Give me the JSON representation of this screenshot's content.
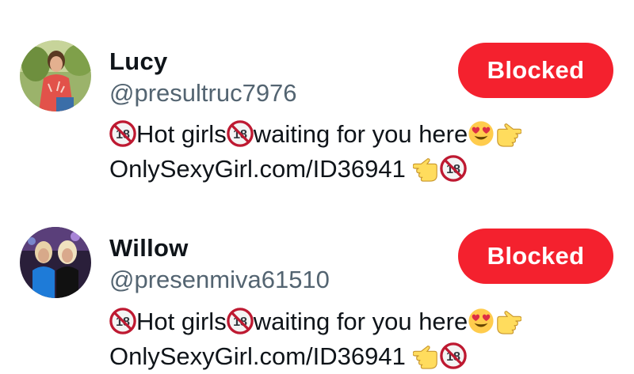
{
  "blocked_users": [
    {
      "name": "Lucy",
      "handle": "@presultruc7976",
      "button_label": "Blocked",
      "bio": {
        "line1_part1": "Hot girls",
        "line1_part2": "waiting for you here",
        "line2_text": "OnlySexyGirl.com/ID36941",
        "icons": [
          "no-under-18-icon",
          "heart-eyes-emoji-icon",
          "pointing-right-icon",
          "pointing-left-icon"
        ]
      }
    },
    {
      "name": "Willow",
      "handle": "@presenmiva61510",
      "button_label": "Blocked",
      "bio": {
        "line1_part1": "Hot girls",
        "line1_part2": "waiting for you here",
        "line2_text": "OnlySexyGirl.com/ID36941",
        "icons": [
          "no-under-18-icon",
          "heart-eyes-emoji-icon",
          "pointing-right-icon",
          "pointing-left-icon"
        ]
      }
    }
  ],
  "colors": {
    "blocked_button_bg": "#f4212e",
    "handle_text": "#536471",
    "primary_text": "#0f1419"
  }
}
